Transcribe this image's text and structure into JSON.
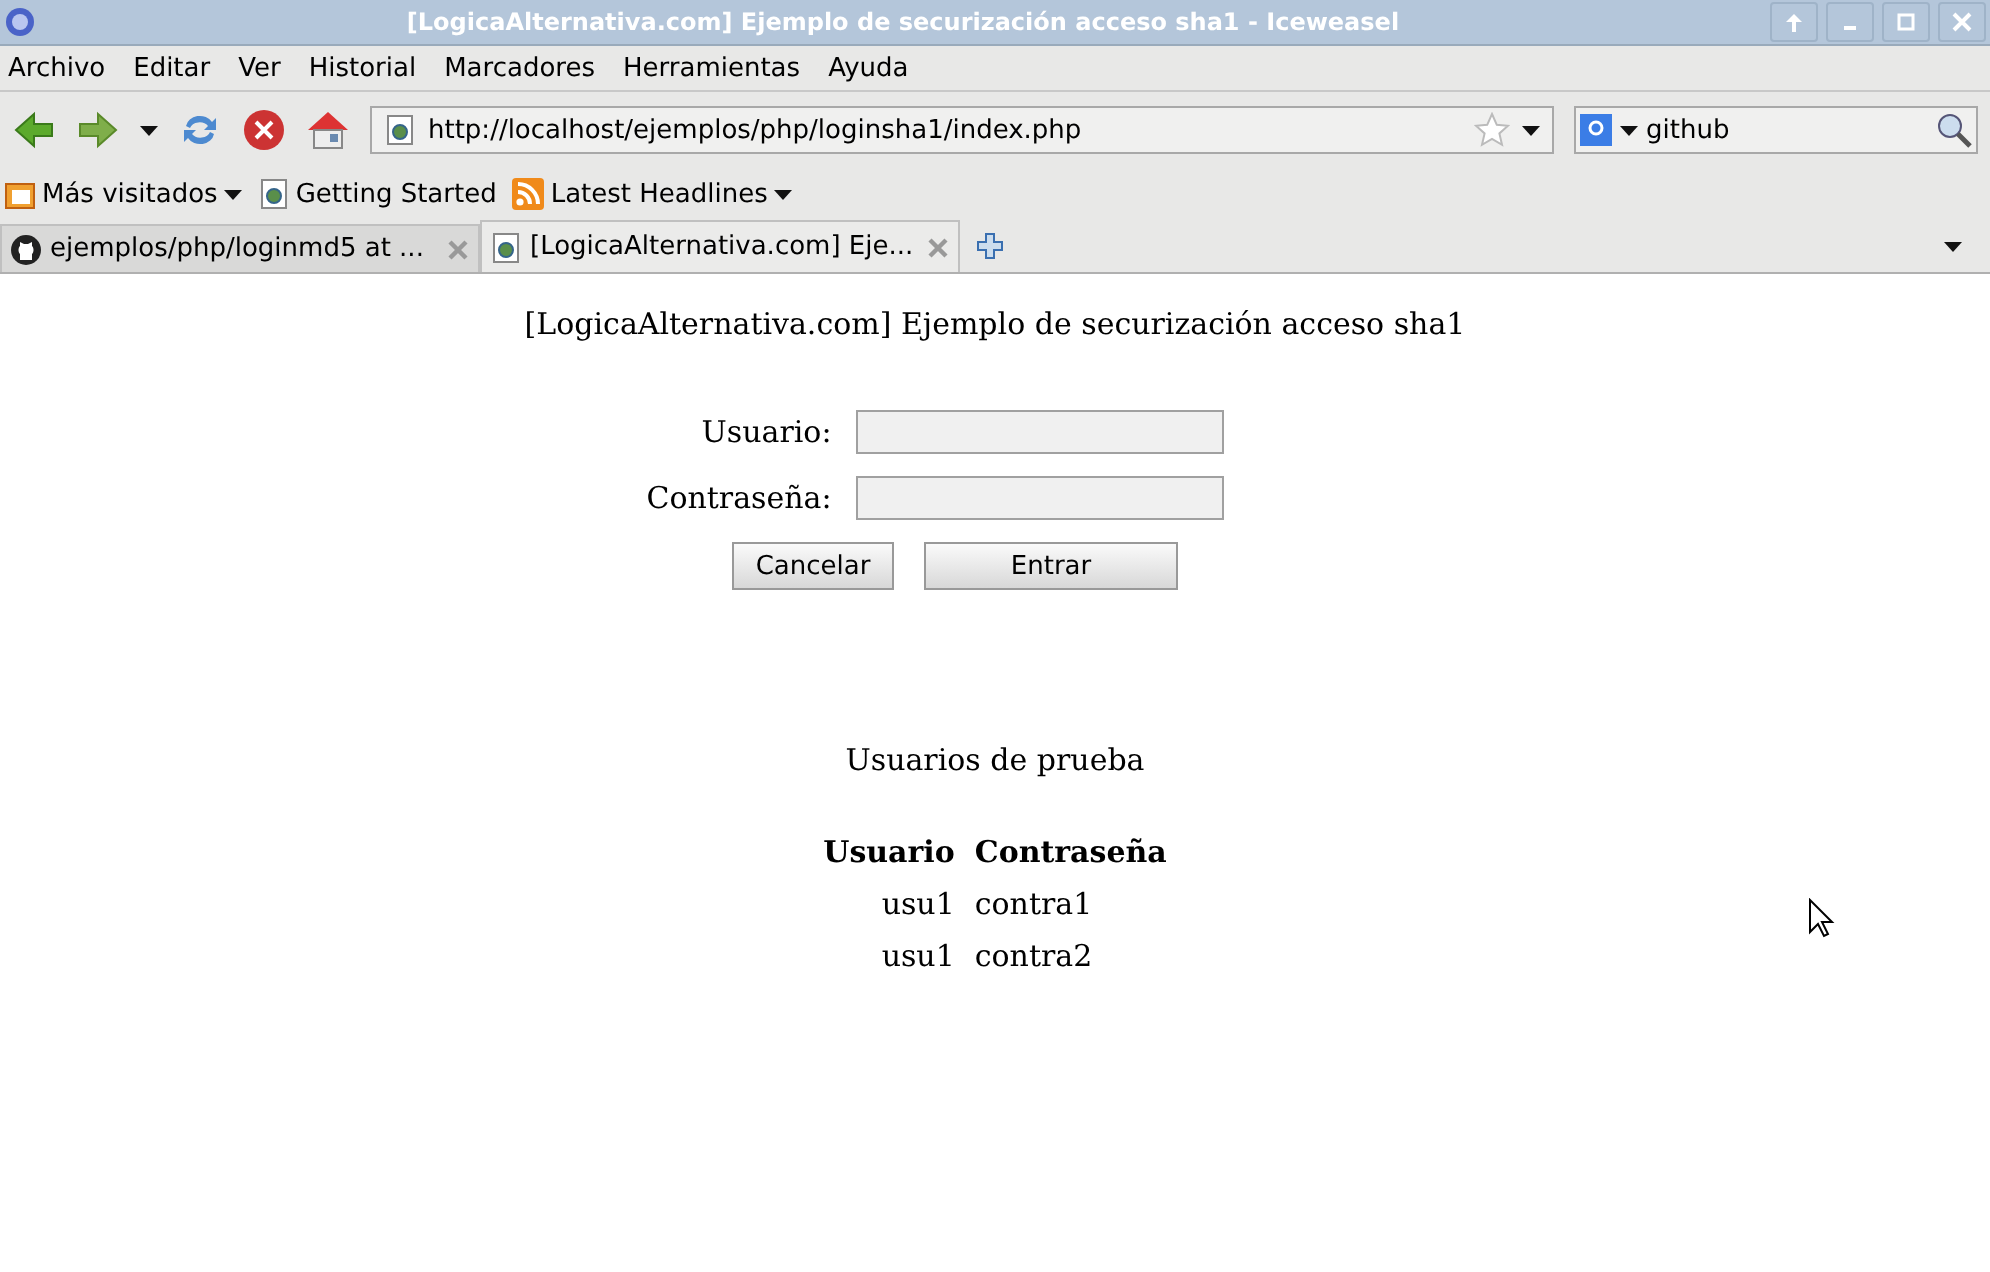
{
  "window": {
    "title": "[LogicaAlternativa.com] Ejemplo de securización acceso sha1 - Iceweasel"
  },
  "menu": [
    "Archivo",
    "Editar",
    "Ver",
    "Historial",
    "Marcadores",
    "Herramientas",
    "Ayuda"
  ],
  "address_bar": {
    "value": "http://localhost/ejemplos/php/loginsha1/index.php"
  },
  "search": {
    "value": "github"
  },
  "bookmarks": [
    {
      "label": "Más visitados",
      "kind": "folder"
    },
    {
      "label": "Getting Started",
      "kind": "page"
    },
    {
      "label": "Latest Headlines",
      "kind": "feed"
    }
  ],
  "tabs": [
    {
      "label": "ejemplos/php/loginmd5 at ...",
      "selected": false,
      "kind": "github"
    },
    {
      "label": "[LogicaAlternativa.com] Eje...",
      "selected": true,
      "kind": "page"
    }
  ],
  "page": {
    "heading": "[LogicaAlternativa.com] Ejemplo de securización acceso sha1",
    "fields": [
      {
        "label": "Usuario:"
      },
      {
        "label": "Contraseña:"
      }
    ],
    "buttons": [
      "Cancelar",
      "Entrar"
    ],
    "subtitle": "Usuarios de prueba",
    "table": {
      "columns": [
        "Usuario",
        "Contraseña"
      ],
      "rows": [
        [
          "usu1",
          "contra1"
        ],
        [
          "usu1",
          "contra2"
        ]
      ]
    }
  }
}
